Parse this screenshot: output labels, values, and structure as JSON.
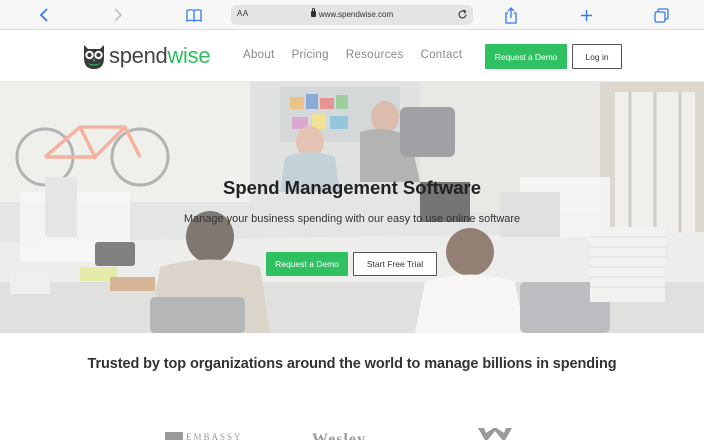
{
  "browser": {
    "text_size_label": "AA",
    "url": "www.spendwise.com"
  },
  "nav": {
    "brand_part1": "spend",
    "brand_part2": "wise",
    "links": [
      "About",
      "Pricing",
      "Resources",
      "Contact"
    ],
    "request_demo": "Request a Demo",
    "log_in": "Log in"
  },
  "hero": {
    "title": "Spend Management Software",
    "subtitle": "Manage your business spending with our easy to use online software",
    "request_demo": "Request a Demo",
    "free_trial": "Start Free Trial"
  },
  "trusted": {
    "heading": "Trusted by top organizations around the world to manage billions in spending"
  },
  "client_logos": {
    "embassy": "EMBASSY",
    "second": "Wesley"
  },
  "colors": {
    "brand_green": "#2ec061",
    "browser_blue": "#3478f6"
  }
}
